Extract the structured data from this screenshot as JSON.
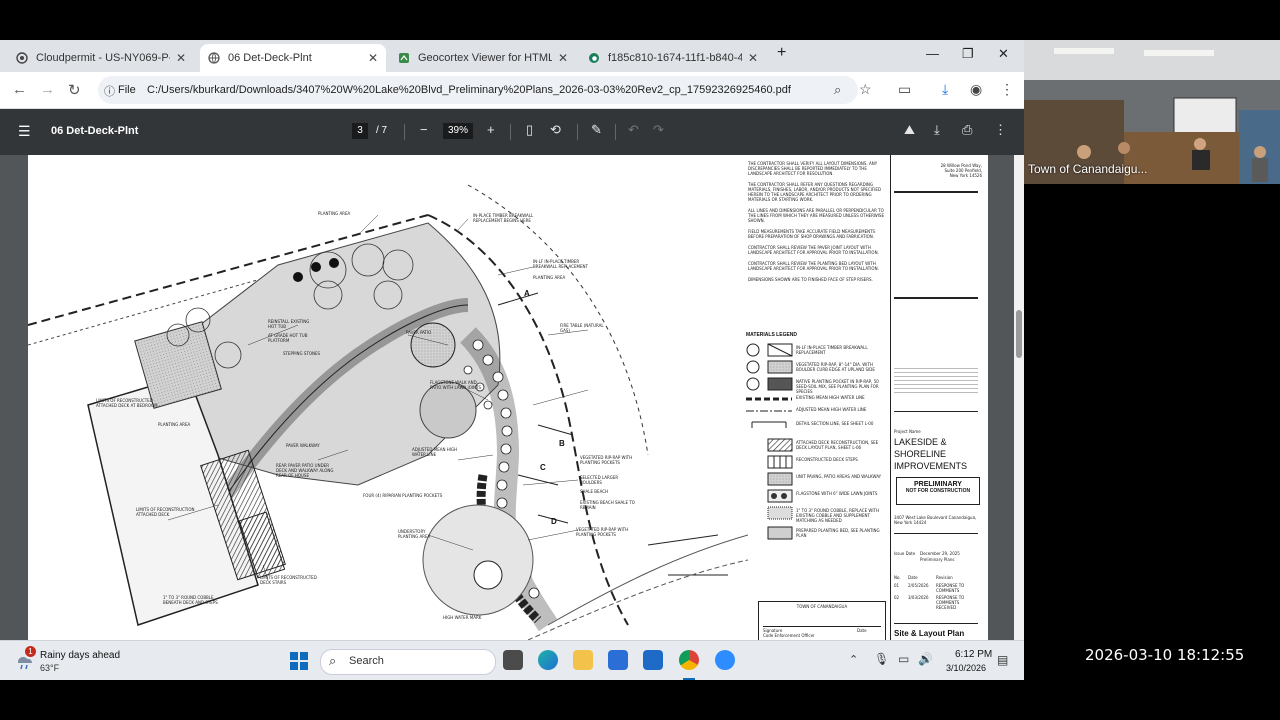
{
  "browser": {
    "tabs": [
      {
        "title": "Cloudpermit - US-NY069-P-20",
        "active": false
      },
      {
        "title": "06 Det-Deck-Plnt",
        "active": true
      },
      {
        "title": "Geocortex Viewer for HTML5",
        "active": false
      },
      {
        "title": "f185c810-1674-11f1-b840-4fe",
        "active": false
      }
    ],
    "protocol_label": "File",
    "url": "C:/Users/kburkard/Downloads/3407%20W%20Lake%20Blvd_Preliminary%20Plans_2026-03-03%20Rev2_cp_17592326925460.pdf"
  },
  "pdf": {
    "doc_name": "06 Det-Deck-Plnt",
    "current_page": "3",
    "total_pages": "/ 7",
    "zoom": "39%"
  },
  "drawing": {
    "plan_notes": [
      "PLANTING AREA",
      "IN-PLACE TIMBER BREAKWALL REPLACEMENT BEGINS HERE",
      "IN-LF IN-PLACE TIMBER BREAKWALL REPLACEMENT",
      "PLANTING AREA",
      "REINSTALL EXISTING HOT TUB",
      "AT GRADE HOT TUB PLATFORM",
      "STEPPING STONES",
      "PAVER PATIO",
      "FIRE TABLE (NATURAL GAS)",
      "FLAGSTONE WALK AND PATIO WITH LAWN JOINTS",
      "LIMITS OF RECONSTRUCTED ATTACHED DECK AT BEDROOM",
      "PLANTING AREA",
      "PAVER WALKWAY",
      "REAR PAVER PATIO UNDER DECK AND WALKWAY ALONG REAR OF HOUSE",
      "ADJUSTED MEAN HIGH WATER LINE",
      "VEGETATED RIP-RAP WITH PLANTING POCKETS",
      "SELECTED LARGER BOULDERS",
      "SHALE BEACH",
      "EXISTING BEACH SHALE TO REMAIN",
      "LIMITS OF RECONSTRUCTION ATTACHED DECK",
      "FOUR (4) RIPARIAN PLANTING POCKETS",
      "UNDERSTORY PLANTING AREA",
      "VEGETATED RIP-RAP WITH PLANTING POCKETS",
      "LIMITS OF RECONSTRUCTED DECK STAIRS",
      "1\" TO 3\" ROUND COBBLE BENEATH DECK AND STEPS",
      "HIGH WATER MARK"
    ],
    "general_notes": [
      "THE CONTRACTOR SHALL VERIFY ALL LAYOUT DIMENSIONS. ANY DISCREPANCIES SHALL BE REPORTED IMMEDIATELY TO THE LANDSCAPE ARCHITECT FOR RESOLUTION.",
      "THE CONTRACTOR SHALL REFER ANY QUESTIONS REGARDING MATERIALS, FINISHES, LABOR, AND/OR PRODUCTS NOT SPECIFIED HEREIN TO THE LANDSCAPE ARCHITECT PRIOR TO ORDERING MATERIALS OR STARTING WORK.",
      "ALL LINES AND DIMENSIONS ARE PARALLEL OR PERPENDICULAR TO THE LINES FROM WHICH THEY ARE MEASURED UNLESS OTHERWISE SHOWN.",
      "FIELD MEASUREMENTS TAKE ACCURATE FIELD MEASUREMENTS BEFORE PREPARATION OF SHOP DRAWINGS AND FABRICATION.",
      "CONTRACTOR SHALL REVIEW THE PAVER JOINT LAYOUT WITH LANDSCAPE ARCHITECT FOR APPROVAL PRIOR TO INSTALLATION.",
      "CONTRACTOR SHALL REVIEW THE PLANTING BED LAYOUT WITH LANDSCAPE ARCHITECT FOR APPROVAL PRIOR TO INSTALLATION.",
      "DIMENSIONS SHOWN ARE TO FINISHED FACE OF STEP RISERS."
    ],
    "legend_title": "MATERIALS LEGEND",
    "legend_items": [
      "IN-LF IN-PLACE TIMBER BREAKWALL REPLACEMENT",
      "VEGETATED RIP-RAP, 8\"-14\" DIA. WITH BOULDER CURB EDGE AT UPLAND SIDE",
      "NATIVE PLANTING POCKET IN RIP-RAP, 50 SEED-SOIL MIX, SEE PLANTING PLAN FOR SPECIES",
      "EXISTING MEAN HIGH WATER LINE",
      "ADJUSTED MEAN HIGH WATER LINE",
      "DETAIL SECTION LINE, SEE SHEET L-00",
      "ATTACHED DECK RECONSTRUCTION, SEE DECK LAYOUT PLAN, SHEET L-06",
      "RECONSTRUCTED DECK STEPS",
      "UNIT PAVING, PATIO AREAS AND WALKWAY",
      "FLAGSTONE WITH 6\" WIDE LAWN JOINTS",
      "1\" TO 3\" ROUND COBBLE, REPLACE WITH EXISTING COBBLE AND SUPPLEMENT MATCHING AS NEEDED",
      "PREPARED PLANTING BED, SEE PLANTING PLAN"
    ],
    "signature_block": {
      "title": "TOWN OF CANANDAIGUA",
      "signature_label": "Signature",
      "date_label": "Date",
      "official_label": "Code Enforcement Officer"
    },
    "title_block": {
      "firm_address": "28 Willow Pond Way, Suite 200 Penfield, New York 14526",
      "project_label": "Project Name",
      "project_name": "LAKESIDE & SHORELINE IMPROVEMENTS",
      "stamp_line1": "PRELIMINARY",
      "stamp_line2": "NOT FOR CONSTRUCTION",
      "site_address": "3407 West Lake Boulevard Canandaigua, New York 14424",
      "issue_label": "Issue Date",
      "issue_date": "December 29, 2025",
      "issue_desc": "Preliminary Plans",
      "rev_headers": [
        "No.",
        "Date",
        "Revision"
      ],
      "revisions": [
        {
          "no": "01",
          "date": "2/05/2026",
          "desc": "RESPONSE TO COMMENTS"
        },
        {
          "no": "02",
          "date": "3/03/2026",
          "desc": "RESPONSE TO COMMENTS RECEIVED"
        }
      ],
      "sheet_title": "Site & Layout Plan"
    },
    "section_markers": [
      "A",
      "A",
      "B",
      "B",
      "C",
      "C",
      "D",
      "D"
    ]
  },
  "taskbar": {
    "weather_title": "Rainy days ahead",
    "weather_temp": "63°F",
    "weather_badge": "1",
    "search_placeholder": "Search",
    "time": "6:12 PM",
    "date": "3/10/2026"
  },
  "overlay": {
    "camera_label": "Town of Canandaigu...",
    "timestamp": "2026-03-10 18:12:55"
  }
}
